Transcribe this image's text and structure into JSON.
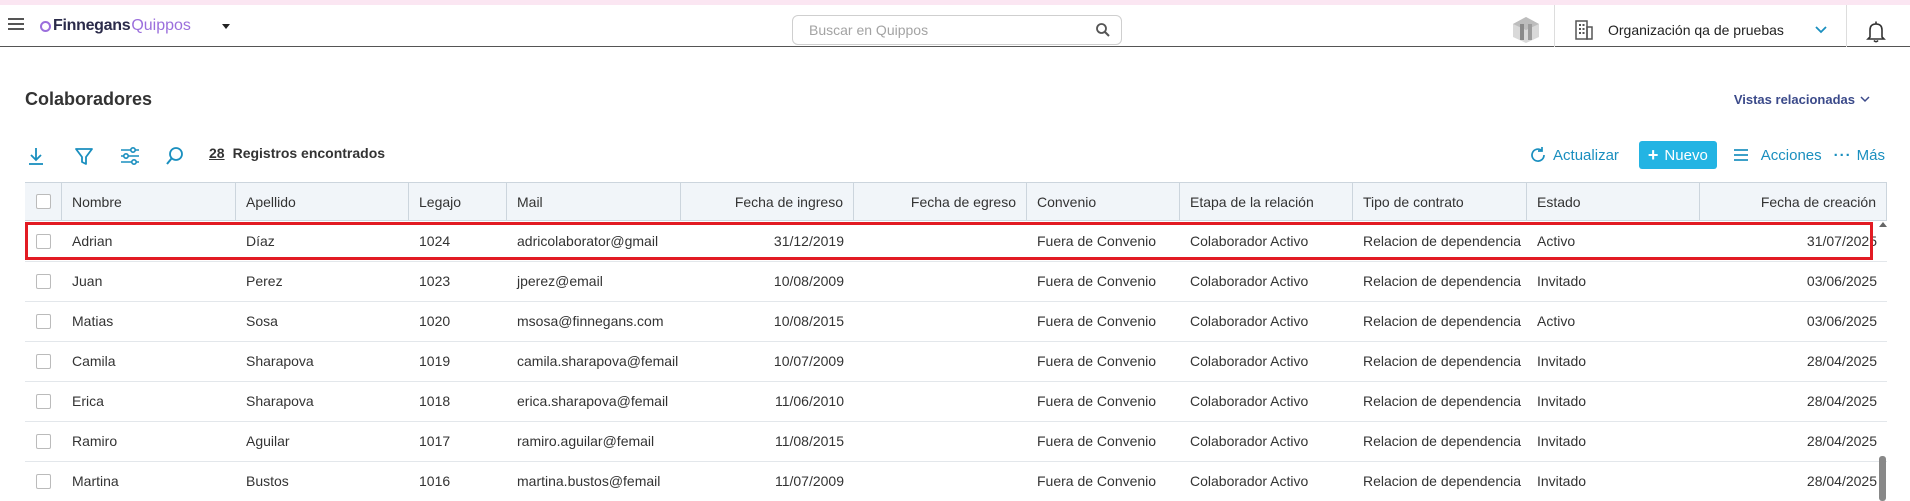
{
  "app": {
    "brand_part1": "Finnegans",
    "brand_part2": "Quippos",
    "search_placeholder": "Buscar en Quippos",
    "organization": "Organización qa de pruebas"
  },
  "page": {
    "title": "Colaboradores",
    "related_views": "Vistas relacionadas"
  },
  "toolbar": {
    "count": "28",
    "count_label": "Registros encontrados",
    "refresh": "Actualizar",
    "new": "Nuevo",
    "actions": "Acciones",
    "more": "Más"
  },
  "table": {
    "columns": [
      "Nombre",
      "Apellido",
      "Legajo",
      "Mail",
      "Fecha de ingreso",
      "Fecha de egreso",
      "Convenio",
      "Etapa de la relación",
      "Tipo de contrato",
      "Estado",
      "Fecha de creación"
    ],
    "rows": [
      [
        "Adrian",
        "Díaz",
        "1024",
        "adricolaborator@gmail",
        "31/12/2019",
        "",
        "Fuera de Convenio",
        "Colaborador Activo",
        "Relacion de dependencia",
        "Activo",
        "31/07/2025"
      ],
      [
        "Juan",
        "Perez",
        "1023",
        "jperez@email",
        "10/08/2009",
        "",
        "Fuera de Convenio",
        "Colaborador Activo",
        "Relacion de dependencia",
        "Invitado",
        "03/06/2025"
      ],
      [
        "Matias",
        "Sosa",
        "1020",
        "msosa@finnegans.com",
        "10/08/2015",
        "",
        "Fuera de Convenio",
        "Colaborador Activo",
        "Relacion de dependencia",
        "Activo",
        "03/06/2025"
      ],
      [
        "Camila",
        "Sharapova",
        "1019",
        "camila.sharapova@femail",
        "10/07/2009",
        "",
        "Fuera de Convenio",
        "Colaborador Activo",
        "Relacion de dependencia",
        "Invitado",
        "28/04/2025"
      ],
      [
        "Erica",
        "Sharapova",
        "1018",
        "erica.sharapova@femail",
        "11/06/2010",
        "",
        "Fuera de Convenio",
        "Colaborador Activo",
        "Relacion de dependencia",
        "Invitado",
        "28/04/2025"
      ],
      [
        "Ramiro",
        "Aguilar",
        "1017",
        "ramiro.aguilar@femail",
        "11/08/2015",
        "",
        "Fuera de Convenio",
        "Colaborador Activo",
        "Relacion de dependencia",
        "Invitado",
        "28/04/2025"
      ],
      [
        "Martina",
        "Bustos",
        "1016",
        "martina.bustos@femail",
        "11/07/2009",
        "",
        "Fuera de Convenio",
        "Colaborador Activo",
        "Relacion de dependencia",
        "Invitado",
        "28/04/2025"
      ]
    ],
    "selected_row": 0
  },
  "icons": {
    "menu": "hamburger-icon",
    "search": "search-icon",
    "download": "download-icon",
    "filter": "filter-icon",
    "settings": "sliders-icon",
    "refresh": "refresh-icon",
    "actions": "list-icon",
    "notifications": "bell-icon"
  },
  "colors": {
    "accent": "#23b4e3",
    "link": "#1a8fbf",
    "brand": "#9b6fdc",
    "highlight": "#e21b23"
  }
}
